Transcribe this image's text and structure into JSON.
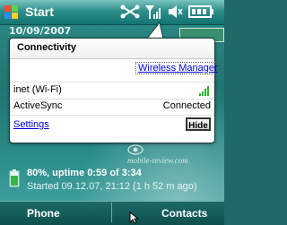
{
  "title_bar": {
    "start_label": "Start",
    "status_icons": [
      "connectivity-icon",
      "signal-strength-icon",
      "speaker-muted-icon",
      "battery-icon"
    ]
  },
  "today": {
    "date_text": "10/09/2007",
    "battery_line": "80%, uptime 0:59 of 3:34",
    "started_line": "Started 09.12.07, 21:12 (1 h 52 m ago)",
    "watermark": "mobile-review.com"
  },
  "popup": {
    "title": "Connectivity",
    "wireless_manager": "Wireless Manager",
    "connections": [
      {
        "name": "inet (Wi-Fi)",
        "state": "",
        "signal_icon": "wifi-signal-icon"
      },
      {
        "name": "ActiveSync",
        "state": "Connected"
      }
    ],
    "settings_label": "Settings",
    "hide_label": "Hide"
  },
  "softkeys": {
    "left": "Phone",
    "right": "Contacts"
  },
  "colors": {
    "title_bar": "#2f8f8a",
    "link": "#0000e0",
    "wifi_signal": "#2fb52f",
    "background": "#1d6a68"
  }
}
